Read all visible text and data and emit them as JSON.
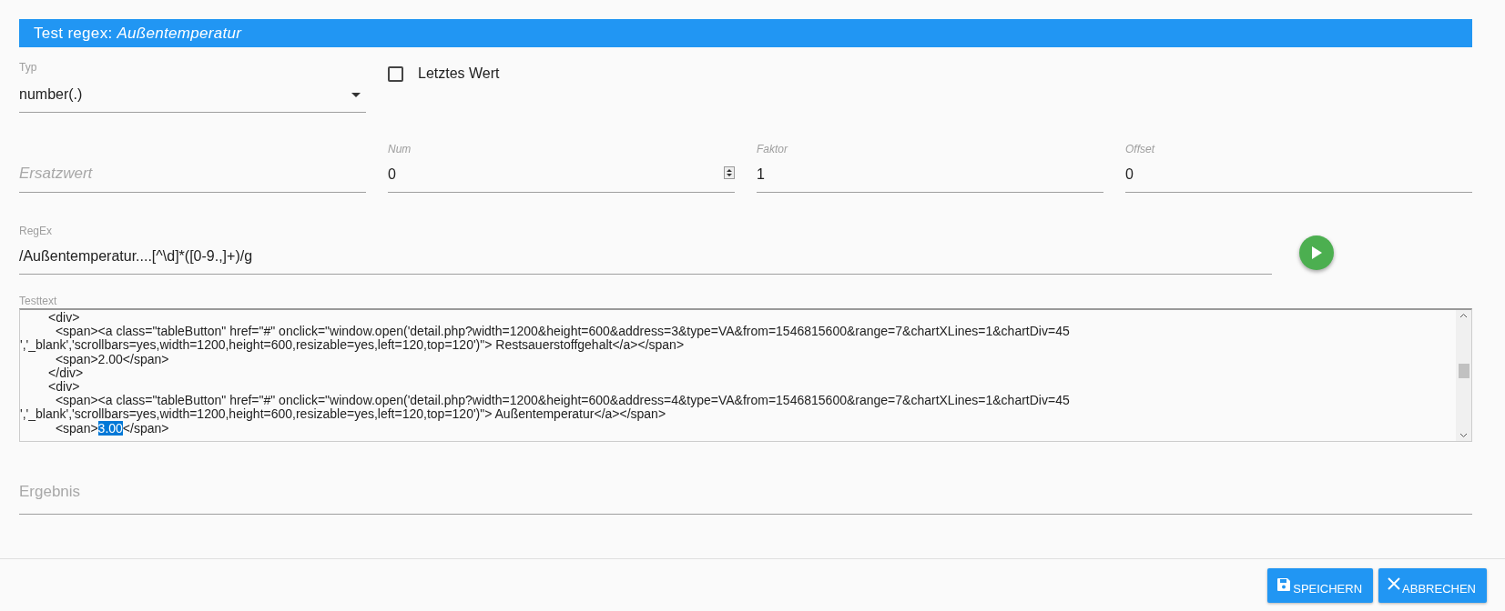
{
  "header": {
    "title": "Test regex: ",
    "subject": "Außentemperatur"
  },
  "type_field": {
    "label": "Typ",
    "value": "number(.)"
  },
  "last_value": {
    "label": "Letztes Wert",
    "checked": false
  },
  "fields": [
    {
      "kind": "text",
      "placeholder": "Ersatzwert"
    },
    {
      "kind": "number",
      "label": "Num",
      "value": "0"
    },
    {
      "kind": "text",
      "label": "Faktor",
      "value": "1"
    },
    {
      "kind": "text",
      "label": "Offset",
      "value": "0"
    }
  ],
  "regex": {
    "label": "RegEx",
    "value": "/Außentemperatur....[^\\d]*([0-9.,]+)/g"
  },
  "testtext": {
    "label": "Testtext",
    "lines": [
      {
        "segments": [
          {
            "text": "        <div>",
            "selected": false
          }
        ]
      },
      {
        "segments": [
          {
            "text": "          <span><a class=\"tableButton\" href=\"#\" onclick=\"window.open('detail.php?width=1200&height=600&address=3&type=VA&from=1546815600&range=7&chartXLines=1&chartDiv=45",
            "selected": false
          }
        ]
      },
      {
        "segments": [
          {
            "text": "','_blank','scrollbars=yes,width=1200,height=600,resizable=yes,left=120,top=120')\"> Restsauerstoffgehalt</a></span>",
            "selected": false
          }
        ]
      },
      {
        "segments": [
          {
            "text": "          <span>2.00</span>",
            "selected": false
          }
        ]
      },
      {
        "segments": [
          {
            "text": "        </div>",
            "selected": false
          }
        ]
      },
      {
        "segments": [
          {
            "text": "        <div>",
            "selected": false
          }
        ]
      },
      {
        "segments": [
          {
            "text": "          <span><a class=\"tableButton\" href=\"#\" onclick=\"window.open('detail.php?width=1200&height=600&address=4&type=VA&from=1546815600&range=7&chartXLines=1&chartDiv=45",
            "selected": false
          }
        ]
      },
      {
        "segments": [
          {
            "text": "','_blank','scrollbars=yes,width=1200,height=600,resizable=yes,left=120,top=120')\"> Außentemperatur</a></span>",
            "selected": false
          }
        ]
      },
      {
        "segments": [
          {
            "text": "          <span>",
            "selected": false
          },
          {
            "text": "3.00",
            "selected": true
          },
          {
            "text": "</span>",
            "selected": false
          }
        ]
      }
    ]
  },
  "result": {
    "placeholder": "Ergebnis"
  },
  "buttons": [
    {
      "kind": "save",
      "label": "SPEICHERN"
    },
    {
      "kind": "cancel",
      "label": "ABBRECHEN"
    }
  ]
}
